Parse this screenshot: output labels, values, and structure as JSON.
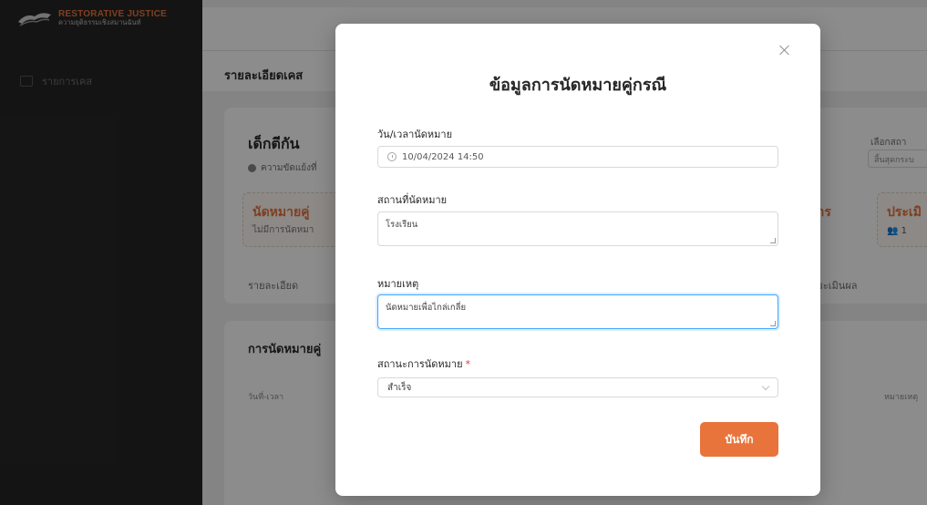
{
  "app": {
    "logo_title": "RESTORATIVE JUSTICE",
    "logo_subtitle": "ความยุติธรรมเชิงสมานฉันท์"
  },
  "sidebar": {
    "items": [
      {
        "label": "รายการเคส",
        "icon": "folder-icon"
      }
    ]
  },
  "page": {
    "title": "รายละเอียดเคส",
    "case_name": "เด็กตีกัน",
    "case_type": "ความขัดแย้งที่",
    "status_card_title": "นัดหมายคู่",
    "status_card_sub": "ไม่มีการนัดหมา",
    "tab_detail": "รายละเอียด",
    "right_label": "เลือกสถา",
    "right_select_value": "สิ้นสุดกระบ",
    "right_card_title": "ประเมิ",
    "right_card_count": "1",
    "frag_card_title": "การ",
    "frag_tab": "ประเมินผล",
    "section_title": "การนัดหมายคู่",
    "col_date": "วันที่-เวลา",
    "col_note": "หมายเหตุ"
  },
  "modal": {
    "title": "ข้อมูลการนัดหมายคู่กรณี",
    "fields": {
      "datetime": {
        "label": "วัน/เวลานัดหมาย",
        "value": "10/04/2024 14:50"
      },
      "location": {
        "label": "สถานที่นัดหมาย",
        "value": "โรงเรียน"
      },
      "note": {
        "label": "หมายเหตุ",
        "value": "นัดหมายเพื่อไกล่เกลี่ย"
      },
      "status": {
        "label": "สถานะการนัดหมาย",
        "required_mark": "*",
        "value": "สำเร็จ"
      }
    },
    "save_label": "บันทึก"
  },
  "colors": {
    "accent": "#e8743b",
    "sidebar": "#262626",
    "focus": "#40a9ff",
    "required": "#e53935"
  }
}
